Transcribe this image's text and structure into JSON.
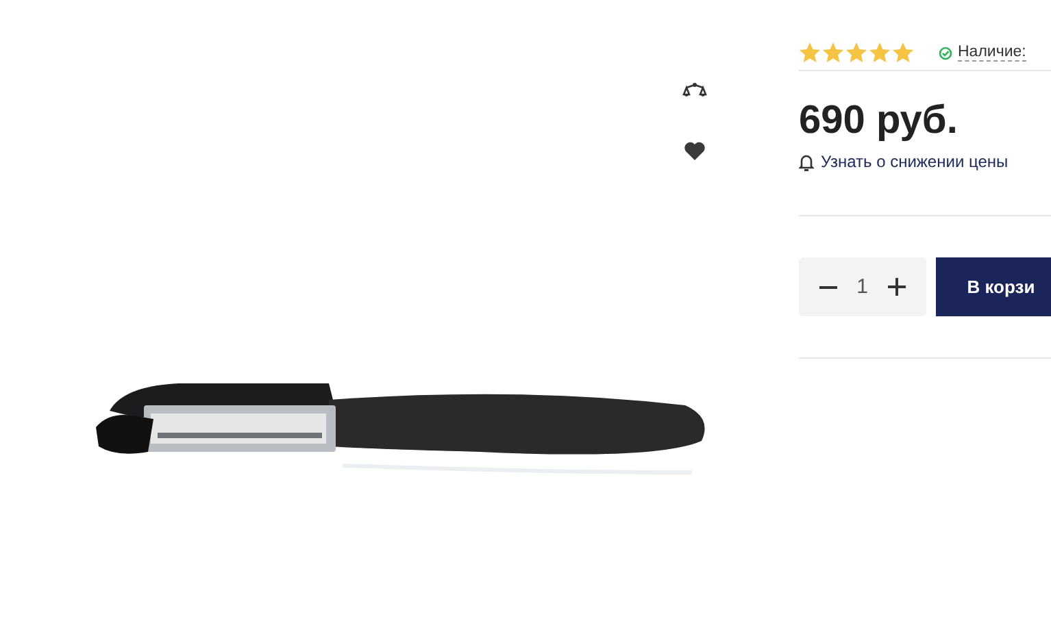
{
  "product": {
    "rating": {
      "stars": 5
    },
    "availability": {
      "in_stock": true,
      "label": "Наличие:"
    },
    "price": "690 руб.",
    "price_alert_link": "Узнать о снижении цены",
    "quantity": "1",
    "add_to_cart": "В корзи"
  }
}
